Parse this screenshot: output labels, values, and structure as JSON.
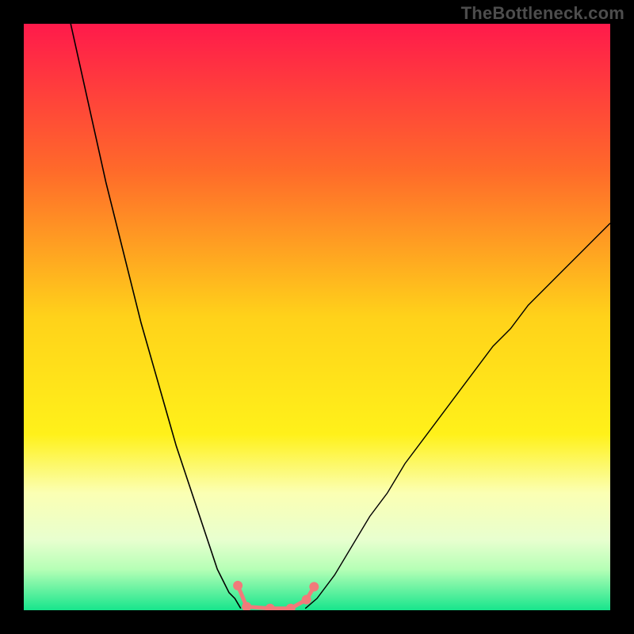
{
  "watermark": "TheBottleneck.com",
  "chart_data": {
    "type": "line",
    "title": "",
    "xlabel": "",
    "ylabel": "",
    "xlim": [
      0,
      100
    ],
    "ylim": [
      0,
      100
    ],
    "background_gradient": {
      "direction": "vertical",
      "stops": [
        {
          "pos": 0.0,
          "color": "#ff1a4b"
        },
        {
          "pos": 0.25,
          "color": "#ff6a2a"
        },
        {
          "pos": 0.5,
          "color": "#ffd21a"
        },
        {
          "pos": 0.7,
          "color": "#fff11a"
        },
        {
          "pos": 0.8,
          "color": "#fbffb3"
        },
        {
          "pos": 0.88,
          "color": "#e8ffcf"
        },
        {
          "pos": 0.93,
          "color": "#b6ffb6"
        },
        {
          "pos": 1.0,
          "color": "#17e58c"
        }
      ]
    },
    "series": [
      {
        "name": "left-curve",
        "color": "#000000",
        "width": 1.6,
        "x": [
          8,
          10,
          12,
          14,
          16,
          18,
          20,
          22,
          24,
          26,
          28,
          30,
          32,
          33,
          34,
          35,
          36,
          37
        ],
        "y": [
          100,
          91,
          82,
          73,
          65,
          57,
          49,
          42,
          35,
          28,
          22,
          16,
          10,
          7,
          5,
          3,
          2,
          0.3
        ]
      },
      {
        "name": "right-curve",
        "color": "#000000",
        "width": 1.4,
        "x": [
          48,
          50,
          53,
          56,
          59,
          62,
          65,
          68,
          71,
          74,
          77,
          80,
          83,
          86,
          89,
          92,
          95,
          98,
          100
        ],
        "y": [
          0.3,
          2,
          6,
          11,
          16,
          20,
          25,
          29,
          33,
          37,
          41,
          45,
          48,
          52,
          55,
          58,
          61,
          64,
          66
        ]
      },
      {
        "name": "marker-chain",
        "type": "marker-chain",
        "color": "#f27a7a",
        "link_width": 5,
        "radius": 6,
        "points": [
          {
            "x": 36.5,
            "y": 4.2
          },
          {
            "x": 38.0,
            "y": 0.6
          },
          {
            "x": 42.0,
            "y": 0.3
          },
          {
            "x": 45.5,
            "y": 0.3
          },
          {
            "x": 48.2,
            "y": 1.8
          },
          {
            "x": 49.5,
            "y": 4.0
          }
        ]
      }
    ]
  }
}
